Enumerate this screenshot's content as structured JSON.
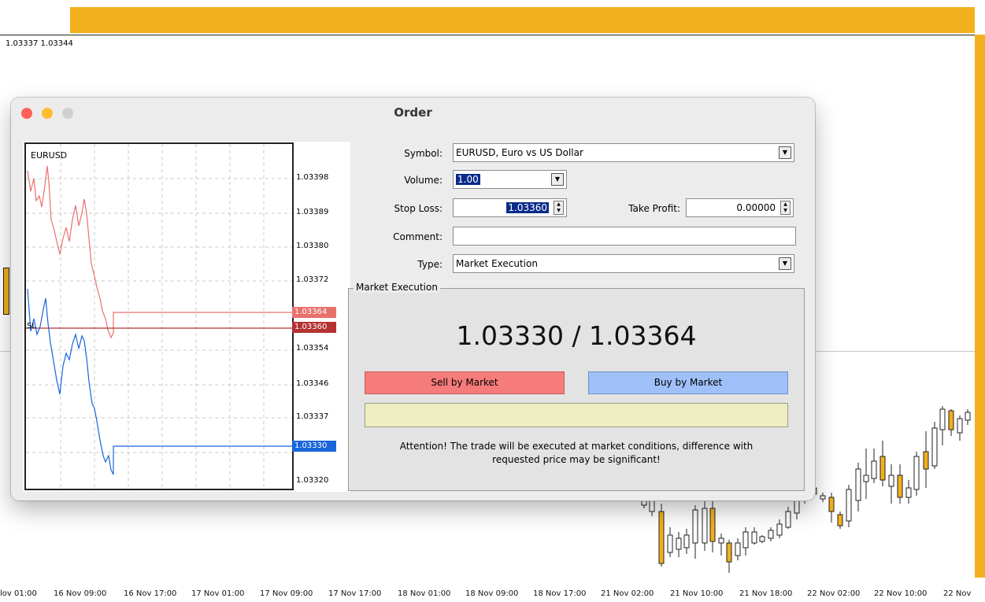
{
  "background": {
    "price_header": "1.03337 1.03344",
    "time_labels": [
      "lov 01:00",
      "16 Nov 09:00",
      "16 Nov 17:00",
      "17 Nov 01:00",
      "17 Nov 09:00",
      "17 Nov 17:00",
      "18 Nov 01:00",
      "18 Nov 09:00",
      "18 Nov 17:00",
      "21 Nov 02:00",
      "21 Nov 10:00",
      "21 Nov 18:00",
      "22 Nov 02:00",
      "22 Nov 10:00",
      "22 Nov"
    ],
    "colors": {
      "bull": "#f2b01e",
      "accent_bar": "#f2b01e"
    }
  },
  "dialog": {
    "title": "Order",
    "chart": {
      "symbol": "EURUSD",
      "y_ticks": [
        "1.03398",
        "1.03389",
        "1.03380",
        "1.03372",
        "1.03354",
        "1.03346",
        "1.03337",
        "1.03320"
      ],
      "ask_label": "1.03364",
      "sl_label": "1.03360",
      "bid_label": "1.03330",
      "sl_marker": "SL",
      "colors": {
        "ask": "#e8716c",
        "sl": "#b43232",
        "bid": "#1a64dc"
      }
    },
    "form": {
      "symbol_label": "Symbol:",
      "symbol_value": "EURUSD, Euro vs US Dollar",
      "volume_label": "Volume:",
      "volume_value": "1.00",
      "stop_loss_label": "Stop Loss:",
      "stop_loss_value": "1.03360",
      "take_profit_label": "Take Profit:",
      "take_profit_value": "0.00000",
      "comment_label": "Comment:",
      "comment_value": "",
      "type_label": "Type:",
      "type_value": "Market Execution"
    },
    "execution": {
      "group_label": "Market Execution",
      "quote": "1.03330 / 1.03364",
      "sell_label": "Sell by Market",
      "buy_label": "Buy by Market",
      "attention_line1": "Attention! The trade will be executed at market conditions, difference with",
      "attention_line2": "requested price may be significant!",
      "colors": {
        "sell": "#f67b7b",
        "buy": "#9fc0f8"
      }
    }
  }
}
